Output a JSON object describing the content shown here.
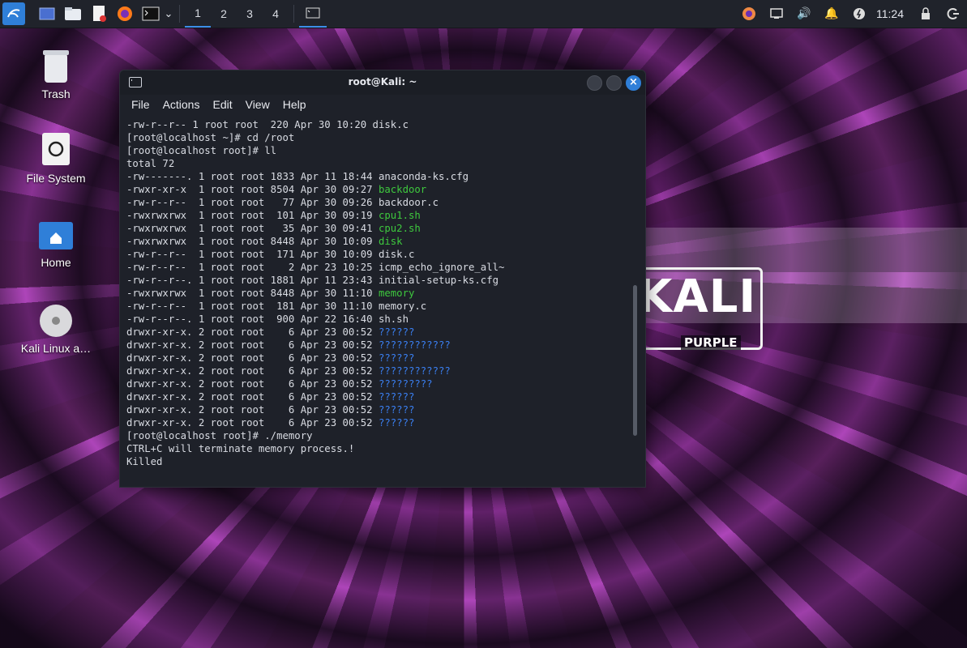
{
  "taskbar": {
    "workspaces": [
      "1",
      "2",
      "3",
      "4"
    ],
    "clock": "11:24"
  },
  "desktop": {
    "icons": [
      {
        "label": "Trash"
      },
      {
        "label": "File System"
      },
      {
        "label": "Home"
      },
      {
        "label": "Kali Linux a…"
      }
    ]
  },
  "banner": {
    "kali": "KALI",
    "purple": "PURPLE"
  },
  "terminal": {
    "title": "root@Kali: ~",
    "menu": [
      "File",
      "Actions",
      "Edit",
      "View",
      "Help"
    ],
    "lines": [
      {
        "perm": "-rw-r--r-- 1 root root  220 Apr 30 10:20 ",
        "name": "disk.c",
        "color": "default"
      },
      {
        "perm": "[root@localhost ~]# cd /root",
        "name": "",
        "color": "default"
      },
      {
        "perm": "[root@localhost root]# ll",
        "name": "",
        "color": "default"
      },
      {
        "perm": "total 72",
        "name": "",
        "color": "default"
      },
      {
        "perm": "-rw-------. 1 root root 1833 Apr 11 18:44 ",
        "name": "anaconda-ks.cfg",
        "color": "default"
      },
      {
        "perm": "-rwxr-xr-x  1 root root 8504 Apr 30 09:27 ",
        "name": "backdoor",
        "color": "green"
      },
      {
        "perm": "-rw-r--r--  1 root root   77 Apr 30 09:26 ",
        "name": "backdoor.c",
        "color": "default"
      },
      {
        "perm": "-rwxrwxrwx  1 root root  101 Apr 30 09:19 ",
        "name": "cpu1.sh",
        "color": "green"
      },
      {
        "perm": "-rwxrwxrwx  1 root root   35 Apr 30 09:41 ",
        "name": "cpu2.sh",
        "color": "green"
      },
      {
        "perm": "-rwxrwxrwx  1 root root 8448 Apr 30 10:09 ",
        "name": "disk",
        "color": "green"
      },
      {
        "perm": "-rw-r--r--  1 root root  171 Apr 30 10:09 ",
        "name": "disk.c",
        "color": "default"
      },
      {
        "perm": "-rw-r--r--  1 root root    2 Apr 23 10:25 ",
        "name": "icmp_echo_ignore_all~",
        "color": "default"
      },
      {
        "perm": "-rw-r--r--. 1 root root 1881 Apr 11 23:43 ",
        "name": "initial-setup-ks.cfg",
        "color": "default"
      },
      {
        "perm": "-rwxrwxrwx  1 root root 8448 Apr 30 11:10 ",
        "name": "memory",
        "color": "green"
      },
      {
        "perm": "-rw-r--r--  1 root root  181 Apr 30 11:10 ",
        "name": "memory.c",
        "color": "default"
      },
      {
        "perm": "-rw-r--r--. 1 root root  900 Apr 22 16:40 ",
        "name": "sh.sh",
        "color": "default"
      },
      {
        "perm": "drwxr-xr-x. 2 root root    6 Apr 23 00:52 ",
        "name": "??????",
        "color": "blue"
      },
      {
        "perm": "drwxr-xr-x. 2 root root    6 Apr 23 00:52 ",
        "name": "????????????",
        "color": "blue"
      },
      {
        "perm": "drwxr-xr-x. 2 root root    6 Apr 23 00:52 ",
        "name": "??????",
        "color": "blue"
      },
      {
        "perm": "drwxr-xr-x. 2 root root    6 Apr 23 00:52 ",
        "name": "????????????",
        "color": "blue"
      },
      {
        "perm": "drwxr-xr-x. 2 root root    6 Apr 23 00:52 ",
        "name": "?????????",
        "color": "blue"
      },
      {
        "perm": "drwxr-xr-x. 2 root root    6 Apr 23 00:52 ",
        "name": "??????",
        "color": "blue"
      },
      {
        "perm": "drwxr-xr-x. 2 root root    6 Apr 23 00:52 ",
        "name": "??????",
        "color": "blue"
      },
      {
        "perm": "drwxr-xr-x. 2 root root    6 Apr 23 00:52 ",
        "name": "??????",
        "color": "blue"
      },
      {
        "perm": "[root@localhost root]# ./memory",
        "name": "",
        "color": "default"
      },
      {
        "perm": "CTRL+C will terminate memory process.!",
        "name": "",
        "color": "default"
      },
      {
        "perm": "Killed",
        "name": "",
        "color": "default"
      }
    ]
  },
  "colors": {
    "accent": "#2f7fd8",
    "exec_green": "#3ec93e",
    "dir_blue": "#3a7ff0",
    "terminal_bg": "#1e2129"
  }
}
